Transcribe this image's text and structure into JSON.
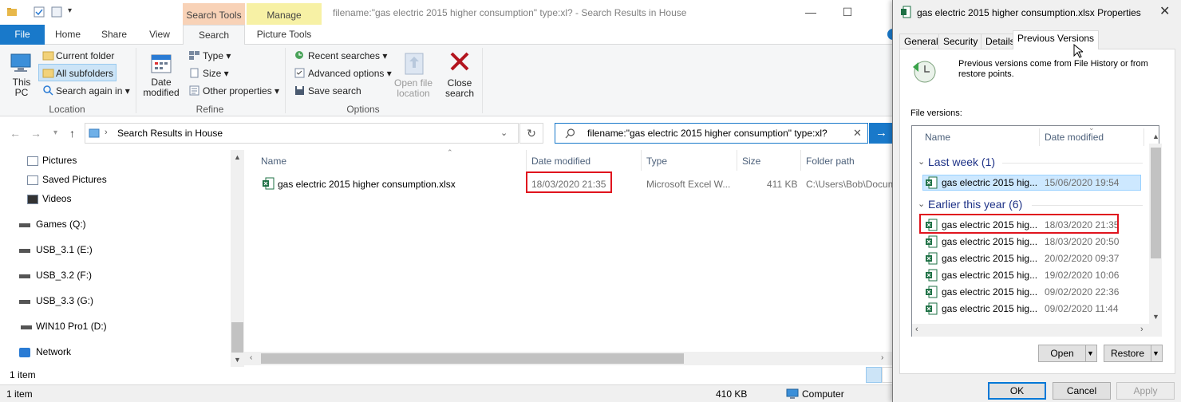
{
  "explorer": {
    "title": "filename:\"gas electric 2015 higher consumption\" type:xl? - Search Results in House",
    "contextual_tabs": {
      "search_tools": "Search Tools",
      "manage": "Manage"
    },
    "tabs": [
      "File",
      "Home",
      "Share",
      "View",
      "Search",
      "Picture Tools"
    ],
    "ribbon": {
      "location": {
        "label": "Location",
        "this_pc": "This PC",
        "current_folder": "Current folder",
        "all_subfolders": "All subfolders",
        "search_again_in": "Search again in"
      },
      "refine": {
        "label": "Refine",
        "date_modified": "Date modified",
        "type": "Type",
        "size": "Size",
        "other_properties": "Other properties"
      },
      "options": {
        "label": "Options",
        "recent_searches": "Recent searches",
        "advanced_options": "Advanced options",
        "save_search": "Save search",
        "open_file_location": "Open file location",
        "close_search": "Close search"
      }
    },
    "address": "Search Results in House",
    "search_query": "filename:\"gas electric 2015 higher consumption\" type:xl?",
    "nav_items": [
      "Pictures",
      "Saved Pictures",
      "Videos",
      "Games (Q:)",
      "USB_3.1 (E:)",
      "USB_3.2 (F:)",
      "USB_3.3 (G:)",
      "WIN10 Pro1 (D:)",
      "Network"
    ],
    "columns": [
      "Name",
      "Date modified",
      "Type",
      "Size",
      "Folder path"
    ],
    "file": {
      "name": "gas electric 2015 higher consumption.xlsx",
      "date_modified": "18/03/2020 21:35",
      "type": "Microsoft Excel W...",
      "size": "411 KB",
      "folder_path": "C:\\Users\\Bob\\Docum"
    },
    "item_count": "1 item",
    "status": {
      "items": "1 item",
      "size": "410 KB",
      "location": "Computer"
    }
  },
  "dialog": {
    "title": "gas electric 2015 higher consumption.xlsx Properties",
    "tabs": [
      "General",
      "Security",
      "Details",
      "Previous Versions"
    ],
    "info": "Previous versions come from File History or from restore points.",
    "versions_label": "File versions:",
    "list_columns": [
      "Name",
      "Date modified"
    ],
    "groups": {
      "last_week": "Last week (1)",
      "earlier": "Earlier this year (6)"
    },
    "last_week_rows": [
      {
        "name": "gas electric 2015 hig...",
        "date": "15/06/2020 19:54"
      }
    ],
    "earlier_rows": [
      {
        "name": "gas electric 2015 hig...",
        "date": "18/03/2020 21:35"
      },
      {
        "name": "gas electric 2015 hig...",
        "date": "18/03/2020 20:50"
      },
      {
        "name": "gas electric 2015 hig...",
        "date": "20/02/2020 09:37"
      },
      {
        "name": "gas electric 2015 hig...",
        "date": "19/02/2020 10:06"
      },
      {
        "name": "gas electric 2015 hig...",
        "date": "09/02/2020 22:36"
      },
      {
        "name": "gas electric 2015 hig...",
        "date": "09/02/2020 11:44"
      }
    ],
    "buttons": {
      "open": "Open",
      "restore": "Restore",
      "ok": "OK",
      "cancel": "Cancel",
      "apply": "Apply"
    }
  },
  "colors": {
    "accent": "#1979ca",
    "highlight_red": "#e0141e",
    "excel_green": "#1d7044"
  }
}
